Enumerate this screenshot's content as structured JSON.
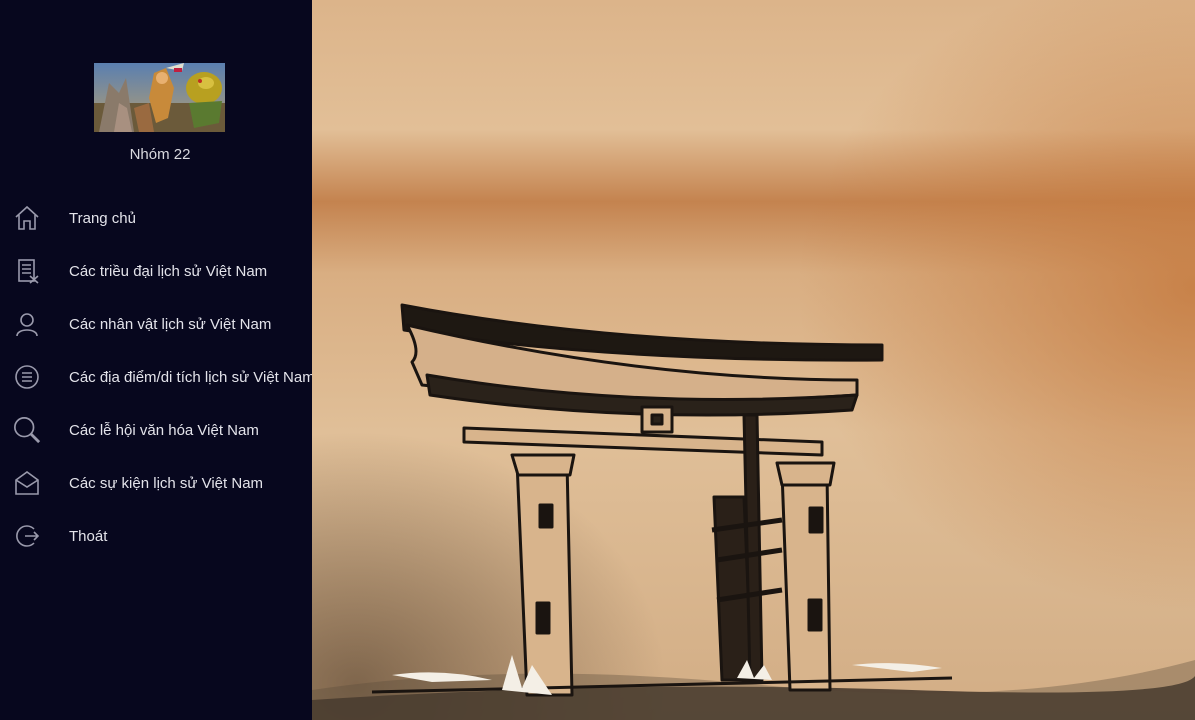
{
  "sidebar": {
    "logo_icon": "heroic-fantasy-artwork",
    "group_name": "Nhóm 22",
    "items": [
      {
        "label": "Trang chủ",
        "icon": "home-icon"
      },
      {
        "label": "Các triều đại lịch sử Việt Nam",
        "icon": "document-list-icon"
      },
      {
        "label": "Các nhân vật lịch sử Việt Nam",
        "icon": "person-icon"
      },
      {
        "label": "Các địa điểm/di tích lịch sử Việt Nam",
        "icon": "list-circle-icon"
      },
      {
        "label": "Các lễ hội văn hóa Việt Nam",
        "icon": "search-icon"
      },
      {
        "label": "Các sự kiện lịch sử Việt Nam",
        "icon": "mail-icon"
      },
      {
        "label": "Thoát",
        "icon": "exit-icon"
      }
    ]
  },
  "content": {
    "background_image": "torii-gate-sketch-on-parchment",
    "colors": {
      "parchment": "#d9b48a",
      "rust": "#c98a52",
      "ink": "#1a1410"
    }
  }
}
